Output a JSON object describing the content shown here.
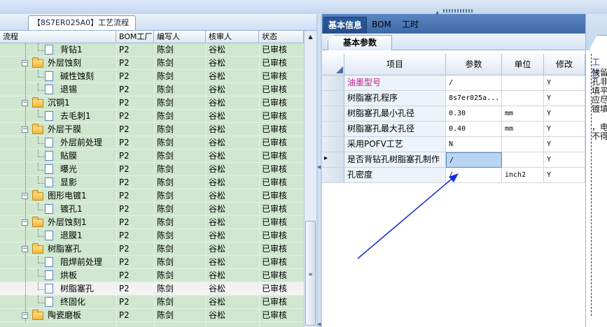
{
  "left_panel": {
    "tab_title": "【8S7ER025A0】工艺流程",
    "columns": [
      "流程",
      "BOM工厂",
      "编写人",
      "核审人",
      "状态"
    ],
    "rows": [
      {
        "name": "背钻1",
        "kind": "doc",
        "plant": "P2",
        "writer": "陈剑",
        "reviewer": "谷松",
        "status": "已审核"
      },
      {
        "name": "外层蚀刻",
        "kind": "folder",
        "plant": "P2",
        "writer": "陈剑",
        "reviewer": "谷松",
        "status": "已审核"
      },
      {
        "name": "碱性蚀刻",
        "kind": "doc",
        "plant": "P2",
        "writer": "陈剑",
        "reviewer": "谷松",
        "status": "已审核"
      },
      {
        "name": "退锡",
        "kind": "doc",
        "plant": "P2",
        "writer": "陈剑",
        "reviewer": "谷松",
        "status": "已审核"
      },
      {
        "name": "沉铜1",
        "kind": "folder",
        "plant": "P2",
        "writer": "陈剑",
        "reviewer": "谷松",
        "status": "已审核"
      },
      {
        "name": "去毛刺1",
        "kind": "doc",
        "plant": "P2",
        "writer": "陈剑",
        "reviewer": "谷松",
        "status": "已审核"
      },
      {
        "name": "外层干膜",
        "kind": "folder",
        "plant": "P2",
        "writer": "陈剑",
        "reviewer": "谷松",
        "status": "已审核"
      },
      {
        "name": "外层前处理",
        "kind": "doc",
        "plant": "P2",
        "writer": "陈剑",
        "reviewer": "谷松",
        "status": "已审核"
      },
      {
        "name": "贴膜",
        "kind": "doc",
        "plant": "P2",
        "writer": "陈剑",
        "reviewer": "谷松",
        "status": "已审核"
      },
      {
        "name": "曝光",
        "kind": "doc",
        "plant": "P2",
        "writer": "陈剑",
        "reviewer": "谷松",
        "status": "已审核"
      },
      {
        "name": "显影",
        "kind": "doc",
        "plant": "P2",
        "writer": "陈剑",
        "reviewer": "谷松",
        "status": "已审核"
      },
      {
        "name": "图形电镀1",
        "kind": "folder",
        "plant": "P2",
        "writer": "陈剑",
        "reviewer": "谷松",
        "status": "已审核"
      },
      {
        "name": "镀孔1",
        "kind": "doc",
        "plant": "P2",
        "writer": "陈剑",
        "reviewer": "谷松",
        "status": "已审核"
      },
      {
        "name": "外层蚀刻1",
        "kind": "folder",
        "plant": "P2",
        "writer": "陈剑",
        "reviewer": "谷松",
        "status": "已审核"
      },
      {
        "name": "退膜1",
        "kind": "doc",
        "plant": "P2",
        "writer": "陈剑",
        "reviewer": "谷松",
        "status": "已审核"
      },
      {
        "name": "树脂塞孔",
        "kind": "folder",
        "plant": "P2",
        "writer": "陈剑",
        "reviewer": "谷松",
        "status": "已审核"
      },
      {
        "name": "阻焊前处理",
        "kind": "doc",
        "plant": "P2",
        "writer": "陈剑",
        "reviewer": "谷松",
        "status": "已审核"
      },
      {
        "name": "烘板",
        "kind": "doc",
        "plant": "P2",
        "writer": "陈剑",
        "reviewer": "谷松",
        "status": "已审核"
      },
      {
        "name": "树脂塞孔",
        "kind": "doc",
        "plant": "P2",
        "writer": "陈剑",
        "reviewer": "谷松",
        "status": "已审核",
        "selected": true
      },
      {
        "name": "终固化",
        "kind": "doc",
        "plant": "P2",
        "writer": "陈剑",
        "reviewer": "谷松",
        "status": "已审核"
      },
      {
        "name": "陶瓷磨板",
        "kind": "folder",
        "plant": "P2",
        "writer": "陈剑",
        "reviewer": "谷松",
        "status": "已审核"
      }
    ]
  },
  "right_panel": {
    "tabs": [
      "基本信息",
      "BOM",
      "工时"
    ],
    "active_tab": "基本信息",
    "subtab": "基本参数",
    "columns": [
      "项目",
      "参数",
      "单位",
      "修改"
    ],
    "rows": [
      {
        "item": "油墨型号",
        "param": "/",
        "unit": "",
        "modify": "Y",
        "highlight": true
      },
      {
        "item": "树脂塞孔程序",
        "param": "8s7er025a...",
        "unit": "",
        "modify": "Y"
      },
      {
        "item": "树脂塞孔最小孔径",
        "param": "0.30",
        "unit": "mm",
        "modify": "Y"
      },
      {
        "item": "树脂塞孔最大孔径",
        "param": "0.40",
        "unit": "mm",
        "modify": "Y"
      },
      {
        "item": "采用POFV工艺",
        "param": "N",
        "unit": "",
        "modify": "Y"
      },
      {
        "item": "是否背钻孔树脂塞孔制作",
        "param": "/",
        "unit": "",
        "modify": "Y",
        "current": true
      },
      {
        "item": "孔密度",
        "param": "/",
        "unit": "inch2",
        "modify": "Y"
      }
    ],
    "colors": {
      "highlight_text": "#c0208a",
      "tab_bar": "#3f6aa8",
      "arrow": "#1a2fd6"
    }
  },
  "far_right": {
    "tab": "工艺",
    "text_lines": [
      "残留",
      "孔非",
      "填平",
      "应尽",
      "镀填",
      "",
      "，电",
      "不得"
    ]
  }
}
